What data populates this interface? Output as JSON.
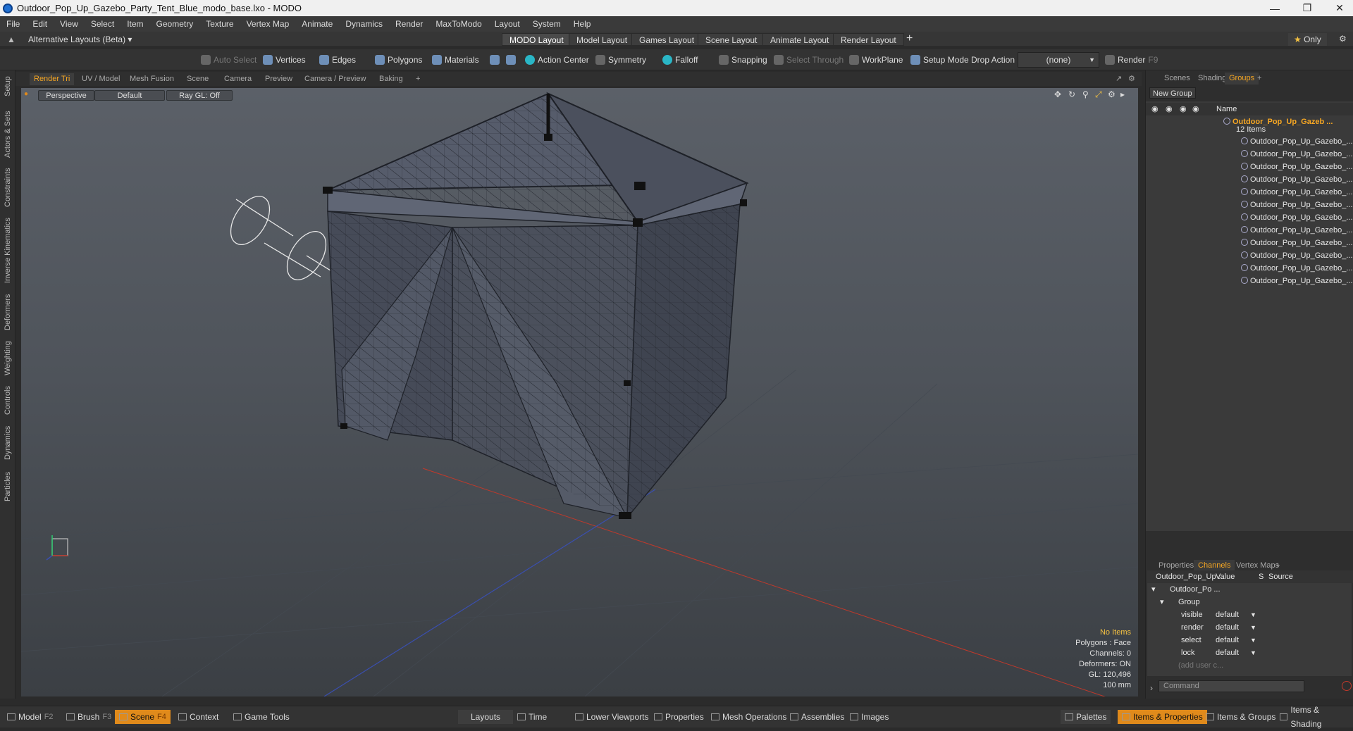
{
  "window": {
    "title": "Outdoor_Pop_Up_Gazebo_Party_Tent_Blue_modo_base.lxo - MODO"
  },
  "menu": [
    "File",
    "Edit",
    "View",
    "Select",
    "Item",
    "Geometry",
    "Texture",
    "Vertex Map",
    "Animate",
    "Dynamics",
    "Render",
    "MaxToModo",
    "Layout",
    "System",
    "Help"
  ],
  "layoutbar": {
    "alt_layouts": "Alternative Layouts (Beta)",
    "tabs": [
      "MODO Layout",
      "Model Layout",
      "Games Layout",
      "Scene Layout",
      "Animate Layout",
      "Render Layout"
    ],
    "only": "Only"
  },
  "toolbar": {
    "auto_select": "Auto Select",
    "vertices": "Vertices",
    "edges": "Edges",
    "polygons": "Polygons",
    "materials": "Materials",
    "action_center": "Action Center",
    "symmetry": "Symmetry",
    "falloff": "Falloff",
    "snapping": "Snapping",
    "select_through": "Select Through",
    "workplane": "WorkPlane",
    "setup_mode": "Setup Mode",
    "drop_action": "Drop Action",
    "drop_value": "(none)",
    "render": "Render",
    "render_key": "F9"
  },
  "leftstrip": [
    "Setup",
    "Actors & Sets",
    "Constraints",
    "Inverse Kinematics",
    "Deformers",
    "Weighting",
    "Controls",
    "Dynamics",
    "Particles"
  ],
  "viewport_tabs": [
    "Render Tri",
    "UV / Model",
    "Mesh Fusion",
    "Scene",
    "Camera",
    "Preview",
    "Camera / Preview",
    "Baking"
  ],
  "viewport": {
    "projection": "Perspective",
    "style": "Default",
    "raygl": "Ray GL: Off",
    "info": {
      "items": "No Items",
      "polygons": "Polygons : Face",
      "channels": "Channels: 0",
      "deformers": "Deformers: ON",
      "gl": "GL: 120,496",
      "unit": "100 mm"
    }
  },
  "right_tabs": [
    "Scenes",
    "Shading",
    "Groups"
  ],
  "groups": {
    "new_group": "New Group",
    "name_header": "Name",
    "root": "Outdoor_Pop_Up_Gazeb ...",
    "root_count": "12 Items",
    "items": [
      "Outdoor_Pop_Up_Gazebo_...",
      "Outdoor_Pop_Up_Gazebo_...",
      "Outdoor_Pop_Up_Gazebo_...",
      "Outdoor_Pop_Up_Gazebo_...",
      "Outdoor_Pop_Up_Gazebo_...",
      "Outdoor_Pop_Up_Gazebo_...",
      "Outdoor_Pop_Up_Gazebo_...",
      "Outdoor_Pop_Up_Gazebo_...",
      "Outdoor_Pop_Up_Gazebo_...",
      "Outdoor_Pop_Up_Gazebo_...",
      "Outdoor_Pop_Up_Gazebo_...",
      "Outdoor_Pop_Up_Gazebo_..."
    ]
  },
  "prop_tabs": [
    "Properties",
    "Channels",
    "Vertex Maps"
  ],
  "channels": {
    "header_name": "Outdoor_Pop_Up ...",
    "header_value": "Value",
    "header_s": "S",
    "header_source": "Source",
    "root": "Outdoor_Po ...",
    "group": "Group",
    "rows": [
      {
        "name": "visible",
        "value": "default"
      },
      {
        "name": "render",
        "value": "default"
      },
      {
        "name": "select",
        "value": "default"
      },
      {
        "name": "lock",
        "value": "default"
      }
    ],
    "add": "(add user c...",
    "command": "Command"
  },
  "bottombar": {
    "model": "Model",
    "model_key": "F2",
    "brush": "Brush",
    "brush_key": "F3",
    "scene": "Scene",
    "scene_key": "F4",
    "context": "Context",
    "game_tools": "Game Tools",
    "layouts": "Layouts",
    "time": "Time",
    "lower_viewports": "Lower Viewports",
    "properties": "Properties",
    "mesh_operations": "Mesh Operations",
    "assemblies": "Assemblies",
    "images": "Images",
    "palettes": "Palettes",
    "items_properties": "Items & Properties",
    "items_groups": "Items & Groups",
    "items_shading": "Items & Shading"
  }
}
